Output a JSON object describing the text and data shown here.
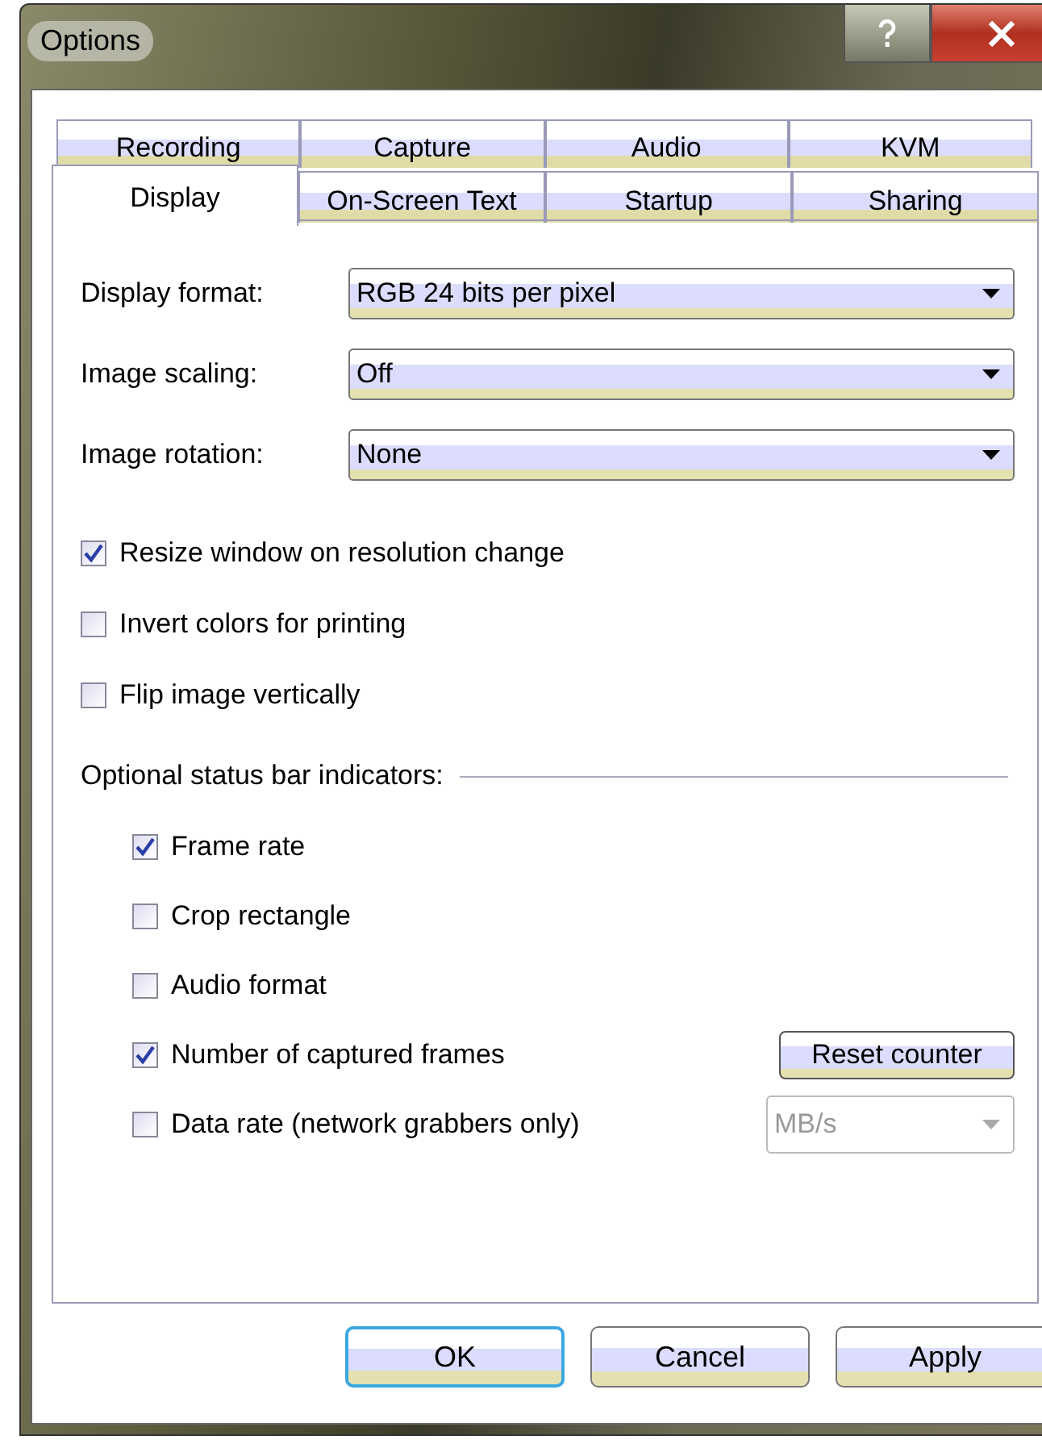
{
  "window": {
    "title": "Options"
  },
  "tab_rows": [
    [
      {
        "label": "Recording",
        "selected": false
      },
      {
        "label": "Capture",
        "selected": false
      },
      {
        "label": "Audio",
        "selected": false
      },
      {
        "label": "KVM",
        "selected": false
      }
    ],
    [
      {
        "label": "Display",
        "selected": true
      },
      {
        "label": "On-Screen Text",
        "selected": false
      },
      {
        "label": "Startup",
        "selected": false
      },
      {
        "label": "Sharing",
        "selected": false
      }
    ]
  ],
  "dropdowns": [
    {
      "label": "Display format:",
      "value": "RGB 24 bits per pixel"
    },
    {
      "label": "Image scaling:",
      "value": "Off"
    },
    {
      "label": "Image rotation:",
      "value": "None"
    }
  ],
  "checkboxes": [
    {
      "label": "Resize window on resolution change",
      "checked": true
    },
    {
      "label": "Invert colors for printing",
      "checked": false
    },
    {
      "label": "Flip image vertically",
      "checked": false
    }
  ],
  "indicators": {
    "heading": "Optional status bar indicators:",
    "items": [
      {
        "label": "Frame rate",
        "checked": true
      },
      {
        "label": "Crop rectangle",
        "checked": false
      },
      {
        "label": "Audio format",
        "checked": false
      },
      {
        "label": "Number of captured frames",
        "checked": true,
        "control": {
          "kind": "button",
          "label": "Reset counter"
        }
      },
      {
        "label": "Data rate (network grabbers only)",
        "checked": false,
        "control": {
          "kind": "dropdown",
          "value": "MB/s",
          "disabled": true
        }
      }
    ]
  },
  "buttons": [
    {
      "label": "OK",
      "focused": true
    },
    {
      "label": "Cancel",
      "focused": false
    },
    {
      "label": "Apply",
      "focused": false
    }
  ]
}
